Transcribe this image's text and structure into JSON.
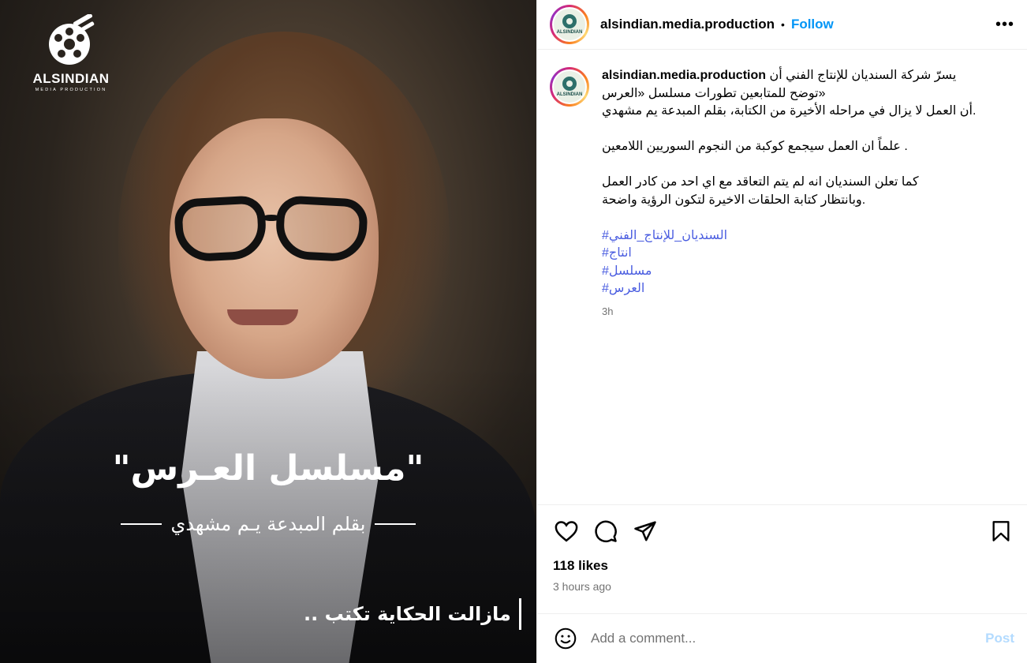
{
  "media": {
    "logo": {
      "brand": "ALSINDIAN",
      "sub": "MEDIA PRODUCTION"
    },
    "overlay_title": "\"مسلسل العـرس\"",
    "overlay_subtitle": "بقلم المبدعة يـم مشهدي",
    "overlay_tagline": "مازالت الحكاية تكتب .."
  },
  "header": {
    "username": "alsindian.media.production",
    "separator": "•",
    "follow_label": "Follow",
    "more_label": "•••",
    "avatar_text": "ALSINDIAN"
  },
  "caption": {
    "username": "alsindian.media.production",
    "lines": {
      "l1": "يسرّ شركة السنديان للإنتاج الفني أن",
      "l2": "توضح للمتابعين تطورات مسلسل «العرس»",
      "l3": "أن العمل لا يزال في مراحله الأخيرة من الكتابة، بقلم المبدعة يم مشهدي.",
      "l4": "علماً ان العمل سيجمع كوكبة من النجوم السوريين اللامعين .",
      "l5": "كما تعلن السنديان انه لم يتم التعاقد مع اي احد من كادر العمل",
      "l6": "وبانتظار كتابة الحلقات الاخيرة لتكون الرؤية واضحة."
    },
    "hashtags": [
      "#السنديان_للإنتاج_الفني",
      "#انتاج",
      "#مسلسل",
      "#العرس"
    ],
    "timestamp": "3h"
  },
  "footer": {
    "likes": "118 likes",
    "ago": "3 hours ago",
    "comment_placeholder": "Add a comment...",
    "post_label": "Post"
  },
  "icons": [
    "heart-icon",
    "comment-icon",
    "share-icon",
    "bookmark-icon",
    "emoji-icon",
    "more-icon"
  ],
  "colors": {
    "follow": "#0095f6",
    "hashtag": "#4a5de0",
    "post_disabled": "#b3dbff",
    "muted": "#737373"
  }
}
